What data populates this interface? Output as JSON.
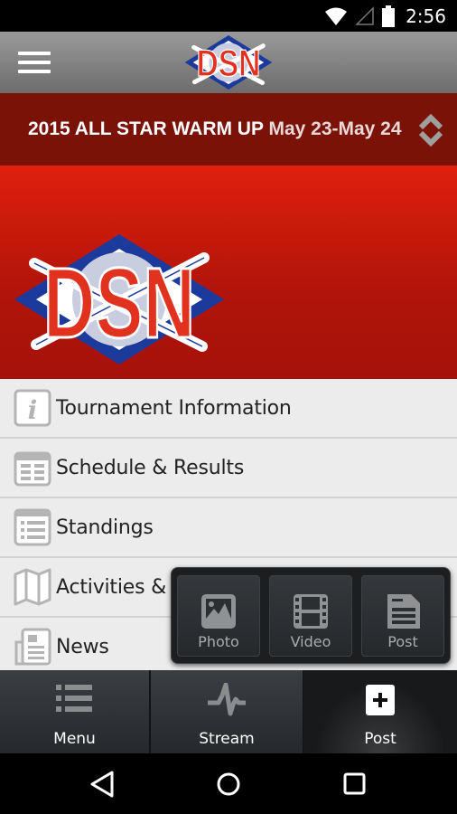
{
  "status_bar": {
    "time": "2:56",
    "icons": [
      "wifi-icon",
      "cell-signal-icon",
      "battery-icon"
    ]
  },
  "header": {
    "menu_icon": "hamburger-icon",
    "logo_text": "DSN"
  },
  "event_selector": {
    "title": "2015 ALL STAR WARM UP",
    "dates": "May 23-May 24",
    "icon": "sort-updown-icon"
  },
  "banner": {
    "logo_text": "DSN"
  },
  "menu": {
    "items": [
      {
        "label": "Tournament Information",
        "icon": "info-icon"
      },
      {
        "label": "Schedule & Results",
        "icon": "calendar-icon"
      },
      {
        "label": "Standings",
        "icon": "list-table-icon"
      },
      {
        "label": "Activities & Events",
        "icon": "map-icon"
      },
      {
        "label": "News",
        "icon": "newspaper-icon"
      }
    ]
  },
  "post_popup": {
    "buttons": [
      {
        "label": "Photo",
        "icon": "photo-icon"
      },
      {
        "label": "Video",
        "icon": "film-icon"
      },
      {
        "label": "Post",
        "icon": "document-icon"
      }
    ]
  },
  "tab_bar": {
    "tabs": [
      {
        "label": "Menu",
        "icon": "list-icon"
      },
      {
        "label": "Stream",
        "icon": "pulse-icon"
      },
      {
        "label": "Post",
        "icon": "plus-icon",
        "active": true
      }
    ]
  },
  "nav_bar": {
    "buttons": [
      "back-icon",
      "home-icon",
      "recents-icon"
    ]
  }
}
